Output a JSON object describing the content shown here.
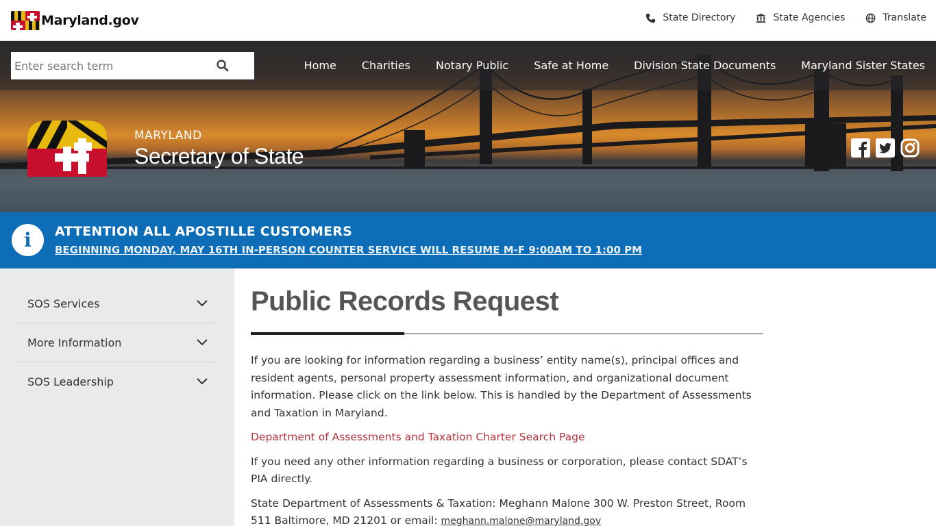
{
  "topbar": {
    "brand": "Maryland.gov",
    "links": [
      {
        "label": "State Directory",
        "icon": "phone-icon"
      },
      {
        "label": "State Agencies",
        "icon": "building-icon"
      },
      {
        "label": "Translate",
        "icon": "globe-icon"
      }
    ]
  },
  "search": {
    "placeholder": "Enter search term",
    "value": ""
  },
  "nav": [
    "Home",
    "Charities",
    "Notary Public",
    "Safe at Home",
    "Division State Documents",
    "Maryland Sister States"
  ],
  "hero": {
    "state": "MARYLAND",
    "office": "Secretary of State"
  },
  "social": [
    "facebook-icon",
    "twitter-icon",
    "instagram-icon"
  ],
  "alert": {
    "title": "ATTENTION ALL APOSTILLE CUSTOMERS",
    "subtitle": "BEGINNING MONDAY, MAY 16TH IN-PERSON COUNTER SERVICE WILL RESUME M-F 9:00AM TO 1:00 PM"
  },
  "sidebar": {
    "items": [
      "SOS Services",
      "More Information",
      "SOS Leadership"
    ]
  },
  "content": {
    "title": "Public Records Request",
    "p1": "If you are looking for information regarding a business’ entity name(s), principal offices and resident agents, personal property assessment information, and organizational document information. Please click on the link below. This is handled by the Department of Assessments and Taxation in Maryland.",
    "link": "Department of Assessments and Taxation Charter Search Page",
    "p2": "If you need any other information regarding a business or corporation, please contact SDAT’s PIA directly.",
    "p3": "State Department of Assessments & Taxation: Meghann Malone 300 W. Preston Street, Room 511 Baltimore, MD 21201 or email:",
    "email": "meghann.malone@maryland.gov"
  },
  "colors": {
    "alert_bg": "#0d6db7",
    "link_red": "#b5343c",
    "sidebar_bg": "#e8eaec"
  }
}
